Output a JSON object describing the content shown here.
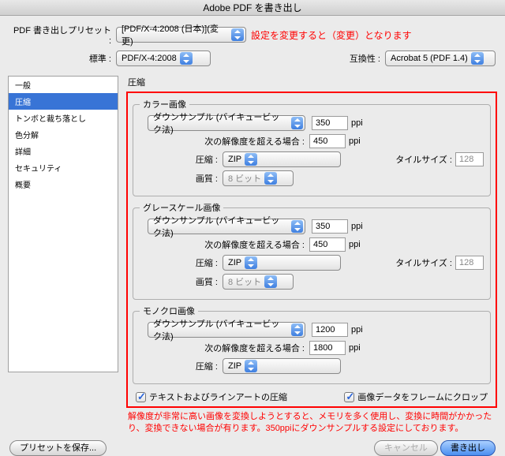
{
  "title": "Adobe PDF を書き出し",
  "top": {
    "preset_label": "PDF 書き出しプリセット :",
    "preset_value": "[PDF/X-4:2008 (日本)](変更)",
    "preset_note": "設定を変更すると（変更）となります",
    "standard_label": "標準 :",
    "standard_value": "PDF/X-4:2008",
    "compat_label": "互換性 :",
    "compat_value": "Acrobat 5 (PDF 1.4)"
  },
  "sidebar": {
    "items": [
      "一般",
      "圧縮",
      "トンボと裁ち落とし",
      "色分解",
      "詳細",
      "セキュリティ",
      "概要"
    ],
    "selected_index": 1
  },
  "section_title": "圧縮",
  "groups": {
    "color": {
      "legend": "カラー画像",
      "downsample": "ダウンサンプル (バイキュービック法)",
      "ppi": "350",
      "ppi_unit": "ppi",
      "above_label": "次の解像度を超える場合 :",
      "above": "450",
      "compress_label": "圧縮 :",
      "compress": "ZIP",
      "tile_label": "タイルサイズ :",
      "tile": "128",
      "quality_label": "画質 :",
      "quality": "8 ビット"
    },
    "gray": {
      "legend": "グレースケール画像",
      "downsample": "ダウンサンプル (バイキュービック法)",
      "ppi": "350",
      "ppi_unit": "ppi",
      "above_label": "次の解像度を超える場合 :",
      "above": "450",
      "compress_label": "圧縮 :",
      "compress": "ZIP",
      "tile_label": "タイルサイズ :",
      "tile": "128",
      "quality_label": "画質 :",
      "quality": "8 ビット"
    },
    "mono": {
      "legend": "モノクロ画像",
      "downsample": "ダウンサンプル (バイキュービック法)",
      "ppi": "1200",
      "ppi_unit": "ppi",
      "above_label": "次の解像度を超える場合 :",
      "above": "1800",
      "compress_label": "圧縮 :",
      "compress": "ZIP"
    }
  },
  "checks": {
    "text_lineart": "テキストおよびラインアートの圧縮",
    "crop_frame": "画像データをフレームにクロップ"
  },
  "footer_note": "解像度が非常に高い画像を変換しようとすると、メモリを多く使用し、変換に時間がかかったり、変換できない場合が有ります。350ppiにダウンサンプルする設定にしております。",
  "buttons": {
    "save_preset": "プリセットを保存...",
    "cancel": "キャンセル",
    "export": "書き出し"
  }
}
